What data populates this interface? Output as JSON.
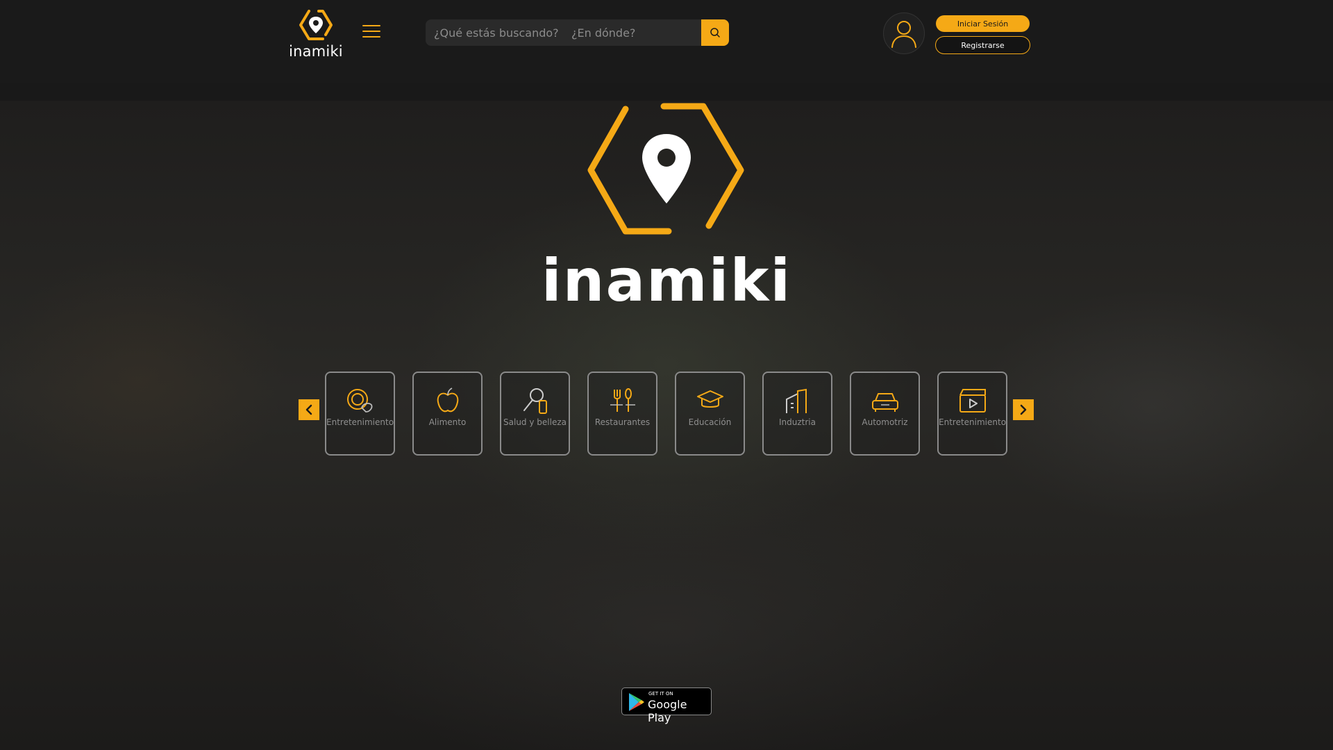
{
  "header": {
    "brand": "inamiki",
    "search": {
      "what_placeholder": "¿Qué estás buscando?",
      "where_placeholder": "¿En dónde?"
    },
    "login_label": "Iniciar Sesión",
    "register_label": "Registrarse"
  },
  "hero": {
    "brand": "inamiki"
  },
  "categories": [
    {
      "label": "Entretenimiento",
      "icon": "entertainment-icon"
    },
    {
      "label": "Alimento",
      "icon": "apple-icon"
    },
    {
      "label": "Salud y belleza",
      "icon": "beauty-icon"
    },
    {
      "label": "Restaurantes",
      "icon": "restaurant-icon"
    },
    {
      "label": "Educación",
      "icon": "graduation-cap-icon"
    },
    {
      "label": "Induztria",
      "icon": "factory-icon"
    },
    {
      "label": "Automotriz",
      "icon": "car-icon"
    },
    {
      "label": "Entretenimiento",
      "icon": "clapperboard-icon"
    }
  ],
  "store_badge": {
    "line1": "GET IT ON",
    "line2": "Google Play"
  },
  "colors": {
    "accent": "#f5a916",
    "background": "#1a1a1a"
  }
}
